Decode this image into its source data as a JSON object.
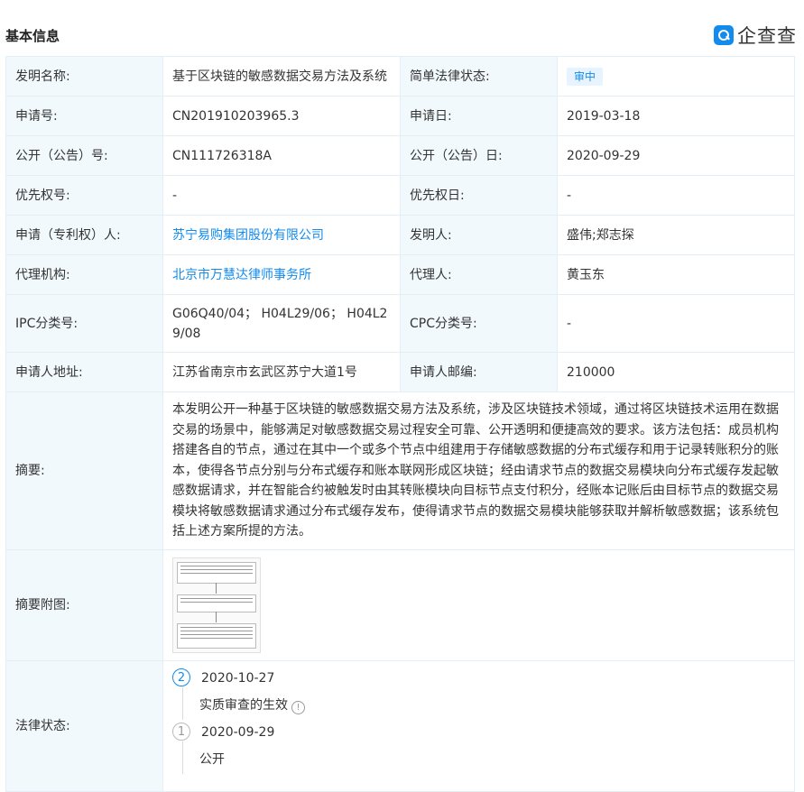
{
  "header": {
    "title": "基本信息",
    "logo_text": "企查查"
  },
  "rows": {
    "invention_name": {
      "label": "发明名称:",
      "value": "基于区块链的敏感数据交易方法及系统"
    },
    "legal_status_simple": {
      "label": "简单法律状态:",
      "value": "审中"
    },
    "application_no": {
      "label": "申请号:",
      "value": "CN201910203965.3"
    },
    "application_date": {
      "label": "申请日:",
      "value": "2019-03-18"
    },
    "publication_no": {
      "label": "公开（公告）号:",
      "value": "CN111726318A"
    },
    "publication_date": {
      "label": "公开（公告）日:",
      "value": "2020-09-29"
    },
    "priority_no": {
      "label": "优先权号:",
      "value": "-"
    },
    "priority_date": {
      "label": "优先权日:",
      "value": "-"
    },
    "applicant": {
      "label": "申请（专利权）人:",
      "value": "苏宁易购集团股份有限公司"
    },
    "inventor": {
      "label": "发明人:",
      "value": "盛伟;郑志探"
    },
    "agency": {
      "label": "代理机构:",
      "value": "北京市万慧达律师事务所"
    },
    "agent": {
      "label": "代理人:",
      "value": "黄玉东"
    },
    "ipc": {
      "label": "IPC分类号:",
      "line1": "G06Q40/04； H04L29/06； H04L2",
      "line2": "9/08"
    },
    "cpc": {
      "label": "CPC分类号:",
      "value": "-"
    },
    "address": {
      "label": "申请人地址:",
      "value": "江苏省南京市玄武区苏宁大道1号"
    },
    "postcode": {
      "label": "申请人邮编:",
      "value": "210000"
    },
    "abstract": {
      "label": "摘要:",
      "lines": [
        "本发明公开一种基于区块链的敏感数据交易方法及系统，涉及区块链技术领域，通过将区块链技术运用在数据",
        "交易的场景中，能够满足对敏感数据交易过程安全可靠、公开透明和便捷高效的要求。该方法包括：成员机构",
        "搭建各自的节点，通过在其中一个或多个节点中组建用于存储敏感数据的分布式缓存和用于记录转账积分的账",
        "本，使得各节点分别与分布式缓存和账本联网形成区块链；经由请求节点的数据交易模块向分布式缓存发起敏",
        "感数据请求，并在智能合约被触发时由其转账模块向目标节点支付积分，经账本记账后由目标节点的数据交易",
        "模块将敏感数据请求通过分布式缓存发布，使得请求节点的数据交易模块能够获取并解析敏感数据；该系统包",
        "括上述方案所提的方法。"
      ]
    },
    "abstract_figure": {
      "label": "摘要附图:"
    },
    "legal_status": {
      "label": "法律状态:",
      "events": [
        {
          "num": "2",
          "date": "2020-10-27",
          "text": "实质审查的生效"
        },
        {
          "num": "1",
          "date": "2020-09-29",
          "text": "公开"
        }
      ]
    }
  }
}
